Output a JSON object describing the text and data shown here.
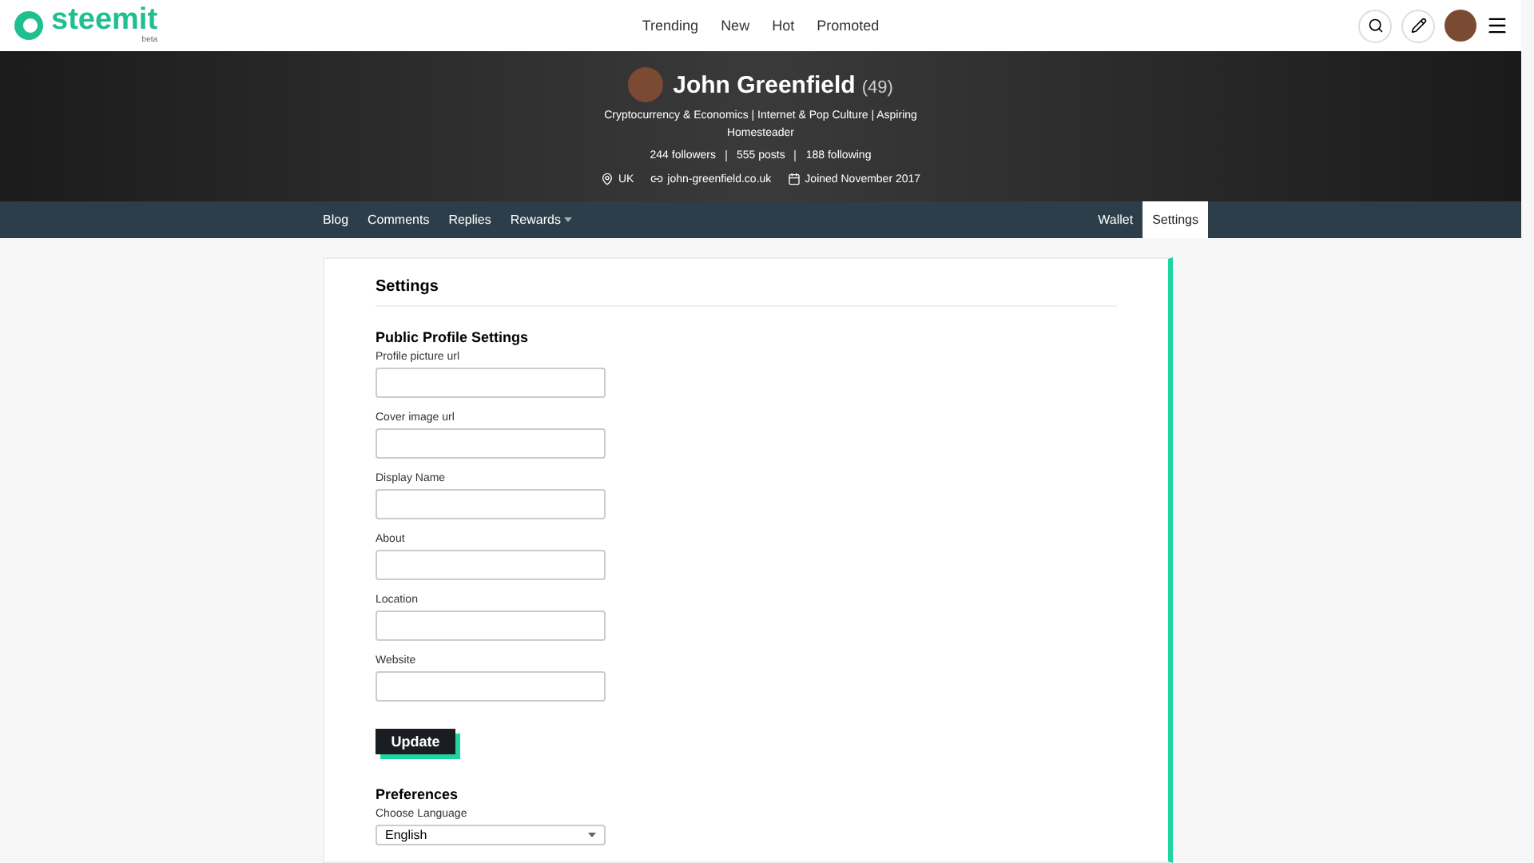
{
  "header": {
    "logo": "steemit",
    "logo_badge": "beta",
    "nav": [
      {
        "label": "Trending"
      },
      {
        "label": "New"
      },
      {
        "label": "Hot"
      },
      {
        "label": "Promoted"
      }
    ]
  },
  "profile": {
    "name": "John Greenfield",
    "reputation": "(49)",
    "about_line_1": "Cryptocurrency & Economics | Internet & Pop Culture | Aspiring",
    "about_line_2": "Homesteader",
    "stats": [
      "244 followers",
      "555 posts",
      "188 following"
    ],
    "location": "UK",
    "website": "john-greenfield.co.uk",
    "joined": "Joined November 2017"
  },
  "tabs_left": [
    {
      "label": "Blog",
      "selected": false,
      "dropdown": false
    },
    {
      "label": "Comments",
      "selected": false,
      "dropdown": false
    },
    {
      "label": "Replies",
      "selected": false,
      "dropdown": false
    },
    {
      "label": "Rewards",
      "selected": false,
      "dropdown": true
    }
  ],
  "tabs_right": [
    {
      "label": "Wallet",
      "selected": false
    },
    {
      "label": "Settings",
      "selected": true
    }
  ],
  "settings": {
    "title": "Settings",
    "section": "Public Profile Settings",
    "fields": [
      {
        "label": "Profile picture url"
      },
      {
        "label": "Cover image url"
      },
      {
        "label": "Display Name"
      },
      {
        "label": "About"
      },
      {
        "label": "Location"
      },
      {
        "label": "Website"
      }
    ],
    "update_button": "Update",
    "preferences_title": "Preferences",
    "language_label": "Choose Language",
    "language_value": "English"
  }
}
